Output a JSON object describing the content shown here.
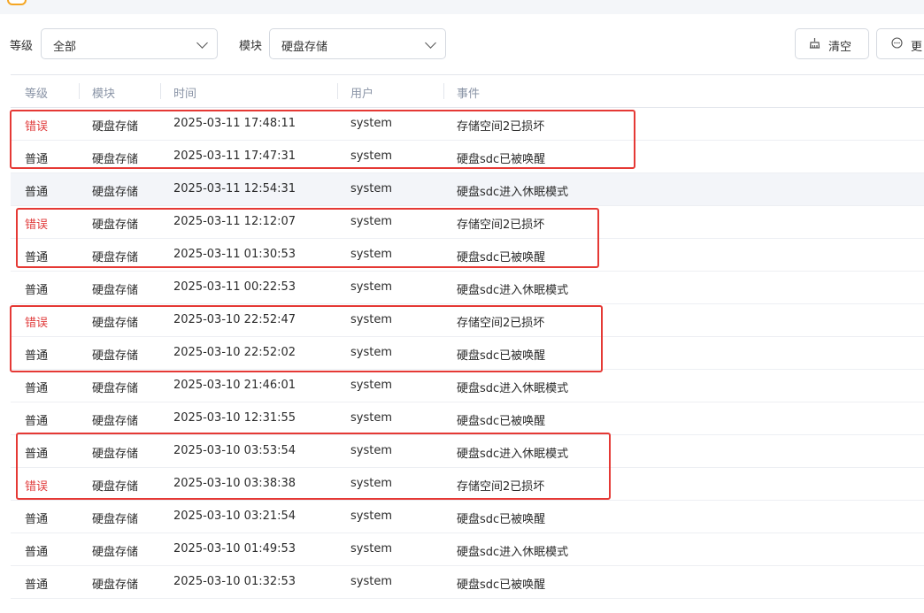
{
  "filters": {
    "level_label": "等级",
    "level_value": "全部",
    "module_label": "模块",
    "module_value": "硬盘存储",
    "clear_button": "清空",
    "more_button": "更"
  },
  "table": {
    "headers": [
      "等级",
      "模块",
      "时间",
      "用户",
      "事件"
    ],
    "rows": [
      {
        "level": "错误",
        "module": "硬盘存储",
        "time": "2025-03-11 17:48:11",
        "user": "system",
        "event": "存储空间2已损坏"
      },
      {
        "level": "普通",
        "module": "硬盘存储",
        "time": "2025-03-11 17:47:31",
        "user": "system",
        "event": "硬盘sdc已被唤醒"
      },
      {
        "level": "普通",
        "module": "硬盘存储",
        "time": "2025-03-11 12:54:31",
        "user": "system",
        "event": "硬盘sdc进入休眠模式"
      },
      {
        "level": "错误",
        "module": "硬盘存储",
        "time": "2025-03-11 12:12:07",
        "user": "system",
        "event": "存储空间2已损坏"
      },
      {
        "level": "普通",
        "module": "硬盘存储",
        "time": "2025-03-11 01:30:53",
        "user": "system",
        "event": "硬盘sdc已被唤醒"
      },
      {
        "level": "普通",
        "module": "硬盘存储",
        "time": "2025-03-11 00:22:53",
        "user": "system",
        "event": "硬盘sdc进入休眠模式"
      },
      {
        "level": "错误",
        "module": "硬盘存储",
        "time": "2025-03-10 22:52:47",
        "user": "system",
        "event": "存储空间2已损坏"
      },
      {
        "level": "普通",
        "module": "硬盘存储",
        "time": "2025-03-10 22:52:02",
        "user": "system",
        "event": "硬盘sdc已被唤醒"
      },
      {
        "level": "普通",
        "module": "硬盘存储",
        "time": "2025-03-10 21:46:01",
        "user": "system",
        "event": "硬盘sdc进入休眠模式"
      },
      {
        "level": "普通",
        "module": "硬盘存储",
        "time": "2025-03-10 12:31:55",
        "user": "system",
        "event": "硬盘sdc已被唤醒"
      },
      {
        "level": "普通",
        "module": "硬盘存储",
        "time": "2025-03-10 03:53:54",
        "user": "system",
        "event": "硬盘sdc进入休眠模式"
      },
      {
        "level": "错误",
        "module": "硬盘存储",
        "time": "2025-03-10 03:38:38",
        "user": "system",
        "event": "存储空间2已损坏"
      },
      {
        "level": "普通",
        "module": "硬盘存储",
        "time": "2025-03-10 03:21:54",
        "user": "system",
        "event": "硬盘sdc已被唤醒"
      },
      {
        "level": "普通",
        "module": "硬盘存储",
        "time": "2025-03-10 01:49:53",
        "user": "system",
        "event": "硬盘sdc进入休眠模式"
      },
      {
        "level": "普通",
        "module": "硬盘存储",
        "time": "2025-03-10 01:32:53",
        "user": "system",
        "event": "硬盘sdc已被唤醒"
      }
    ],
    "highlighted_row": 2
  },
  "colors": {
    "error_level": "#e03c3c",
    "annotation_box": "#e53935",
    "header_text": "#8a94a6"
  },
  "icons": {
    "clear": "broom-icon",
    "more": "more-circle-icon",
    "select_arrow": "chevron-down-icon"
  }
}
